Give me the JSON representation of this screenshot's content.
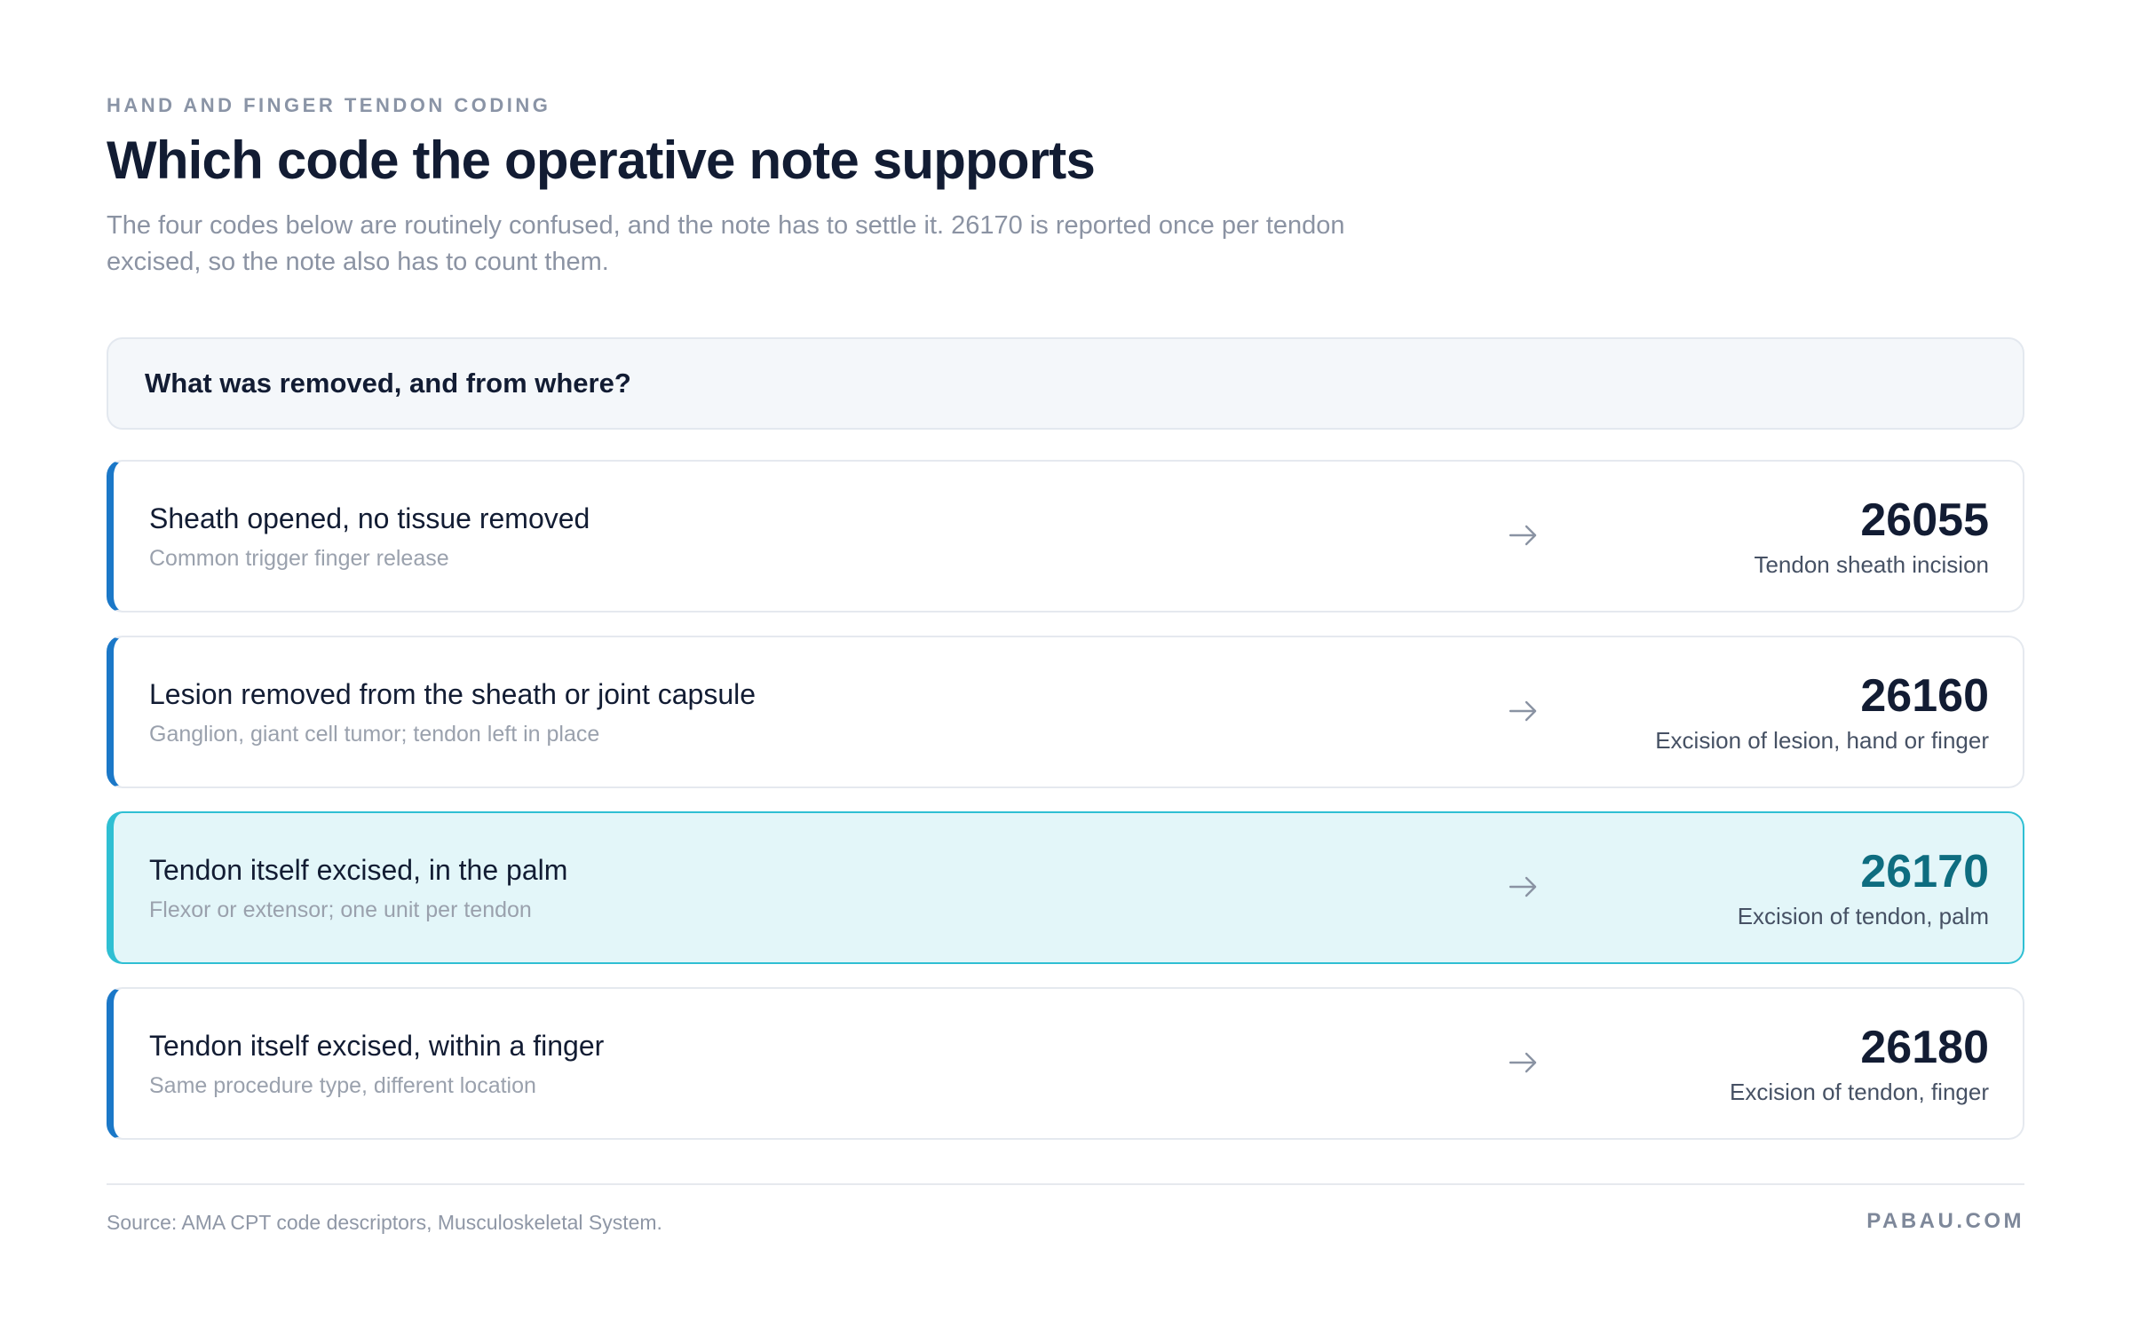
{
  "header": {
    "eyebrow": "HAND AND FINGER TENDON CODING",
    "title": "Which code the operative note supports",
    "subtitle": "The four codes below are routinely confused, and the note has to settle it. 26170 is reported once per tendon excised, so the note also has to count them."
  },
  "question": "What was removed, and from where?",
  "rows": [
    {
      "title": "Sheath opened, no tissue removed",
      "subtitle": "Common trigger finger release",
      "arrow_icon": "arrow-right-icon",
      "code": "26055",
      "code_label": "Tendon sheath incision",
      "highlighted": false
    },
    {
      "title": "Lesion removed from the sheath or joint capsule",
      "subtitle": "Ganglion, giant cell tumor; tendon left in place",
      "arrow_icon": "arrow-right-icon",
      "code": "26160",
      "code_label": "Excision of lesion, hand or finger",
      "highlighted": false
    },
    {
      "title": "Tendon itself excised, in the palm",
      "subtitle": "Flexor or extensor; one unit per tendon",
      "arrow_icon": "arrow-right-icon",
      "code": "26170",
      "code_label": "Excision of tendon, palm",
      "highlighted": true
    },
    {
      "title": "Tendon itself excised, within a finger",
      "subtitle": "Same procedure type, different location",
      "arrow_icon": "arrow-right-icon",
      "code": "26180",
      "code_label": "Excision of tendon, finger",
      "highlighted": false
    }
  ],
  "footer": {
    "source": "Source: AMA CPT code descriptors, Musculoskeletal System.",
    "brand": "PABAU.COM"
  },
  "colors": {
    "accent_blue": "#1b78c8",
    "highlight_teal": "#2fbfd3",
    "highlight_bg": "#e3f6f9",
    "highlight_code": "#0e6d80",
    "text_dark": "#121c33"
  }
}
